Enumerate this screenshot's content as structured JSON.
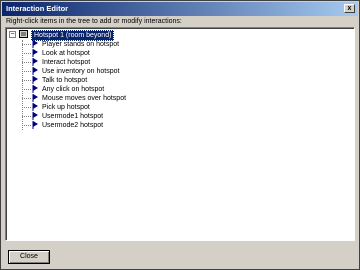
{
  "window": {
    "title": "Interaction Editor",
    "close_glyph": "x"
  },
  "instruction": "Right-click items in the tree to add or modify interactions:",
  "tree": {
    "expander_glyph": "−",
    "root_label": "Hotspot 1 (room beyond)",
    "items": [
      {
        "label": "Player stands on hotspot"
      },
      {
        "label": "Look at hotspot"
      },
      {
        "label": "Interact hotspot"
      },
      {
        "label": "Use inventory on hotspot"
      },
      {
        "label": "Talk to hotspot"
      },
      {
        "label": "Any click on hotspot"
      },
      {
        "label": "Mouse moves over hotspot"
      },
      {
        "label": "Pick up hotspot"
      },
      {
        "label": "Usermode1 hotspot"
      },
      {
        "label": "Usermode2 hotspot"
      }
    ]
  },
  "footer": {
    "close_label": "Close"
  },
  "colors": {
    "title_bar": "#0a246a",
    "selection": "#0a246a",
    "flag": "#000080"
  }
}
